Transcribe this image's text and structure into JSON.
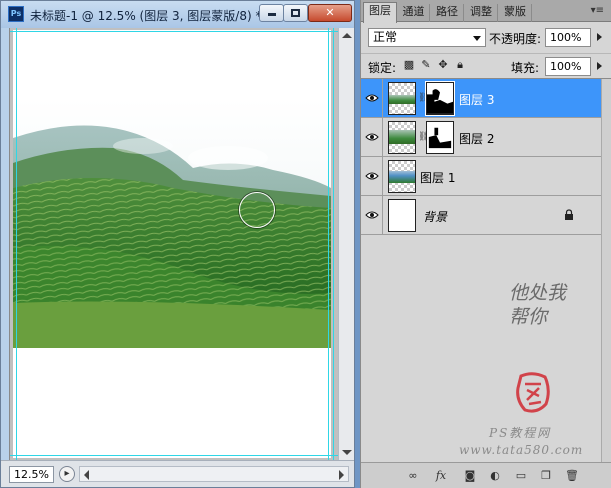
{
  "document": {
    "title": "未标题-1 @ 12.5% (图层 3, 图层蒙版/8) *",
    "app_icon": "Ps",
    "zoom": "12.5%",
    "window_buttons": {
      "minimize": "minimize-icon",
      "maximize": "maximize-icon",
      "close": "close-icon",
      "close_glyph": "✕"
    }
  },
  "panel": {
    "tabs": [
      {
        "label": "图层",
        "active": true
      },
      {
        "label": "通道",
        "active": false
      },
      {
        "label": "路径",
        "active": false
      },
      {
        "label": "调整",
        "active": false
      },
      {
        "label": "蒙版",
        "active": false
      }
    ],
    "blend_mode": "正常",
    "opacity_label": "不透明度:",
    "opacity": "100%",
    "lock_label": "锁定:",
    "fill_label": "填充:",
    "fill": "100%",
    "layers": [
      {
        "name": "图层 3",
        "selected": true,
        "has_mask": true,
        "visible": true
      },
      {
        "name": "图层 2",
        "selected": false,
        "has_mask": true,
        "visible": true
      },
      {
        "name": "图层 1",
        "selected": false,
        "has_mask": false,
        "visible": true
      },
      {
        "name": "背景",
        "selected": false,
        "has_mask": false,
        "visible": true,
        "locked": true
      }
    ],
    "footer_icons": [
      "link-layers-icon",
      "fx-icon",
      "add-mask-icon",
      "adjustment-layer-icon",
      "group-icon",
      "new-layer-icon",
      "delete-layer-icon"
    ],
    "footer_fx": "fx"
  },
  "watermark": {
    "text": "他处我帮你",
    "site1": "PS教程网",
    "site2": "www.tata580.com"
  }
}
